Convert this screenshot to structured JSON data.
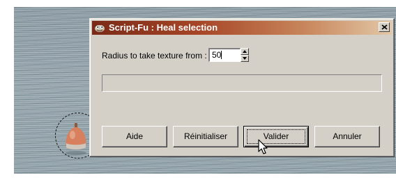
{
  "dialog": {
    "title": "Script-Fu : Heal selection",
    "radius_label": "Radius to take texture from :",
    "radius_value": "50",
    "progress": 0,
    "buttons": {
      "help": "Aide",
      "reset": "Réinitialiser",
      "ok": "Valider",
      "cancel": "Annuler"
    }
  },
  "icons": {
    "app": "gimp-wilber-icon",
    "close": "close-icon",
    "spin_up": "spin-up-icon",
    "spin_down": "spin-down-icon",
    "cursor": "mouse-pointer-icon"
  },
  "colors": {
    "titlebar_start": "#7a2a18",
    "titlebar_end": "#e3c8a8",
    "dialog_face": "#d4d0c8",
    "water": "#8f9ea6",
    "buoy": "#d8805e"
  }
}
